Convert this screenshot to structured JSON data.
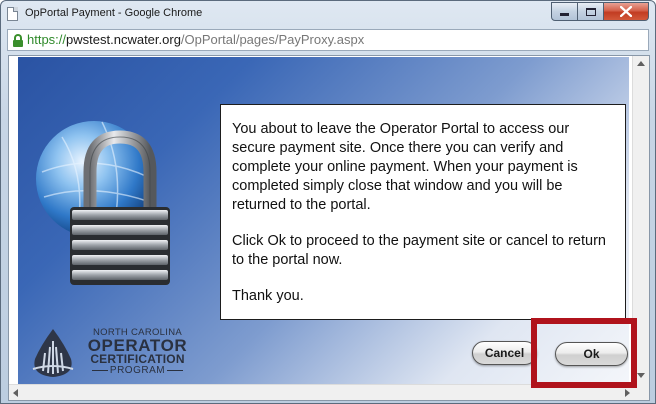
{
  "window": {
    "title": "OpPortal Payment - Google Chrome"
  },
  "address_bar": {
    "scheme": "https://",
    "host": "pwstest.ncwater.org",
    "path": "/OpPortal/pages/PayProxy.aspx"
  },
  "message": {
    "paragraphs": [
      "You about to leave the Operator Portal to access our secure payment site.  Once there you can verify and complete  your online payment.  When your payment is completed simply close that window and you will be returned to the portal.",
      "Click Ok to proceed to the payment site or cancel to return to the portal now.",
      "Thank you."
    ]
  },
  "logo": {
    "line1": "NORTH CAROLINA",
    "line2": "OPERATOR",
    "line3": "CERTIFICATION",
    "line4": "PROGRAM"
  },
  "buttons": {
    "cancel_label": "Cancel",
    "ok_label": "Ok"
  },
  "colors": {
    "highlight": "#b0131c",
    "https_green": "#2f8a2a"
  },
  "icons": {
    "lock": "lock-icon",
    "globe_padlock": "globe-padlock-icon",
    "logo_mark": "water-drop-logo-icon"
  }
}
